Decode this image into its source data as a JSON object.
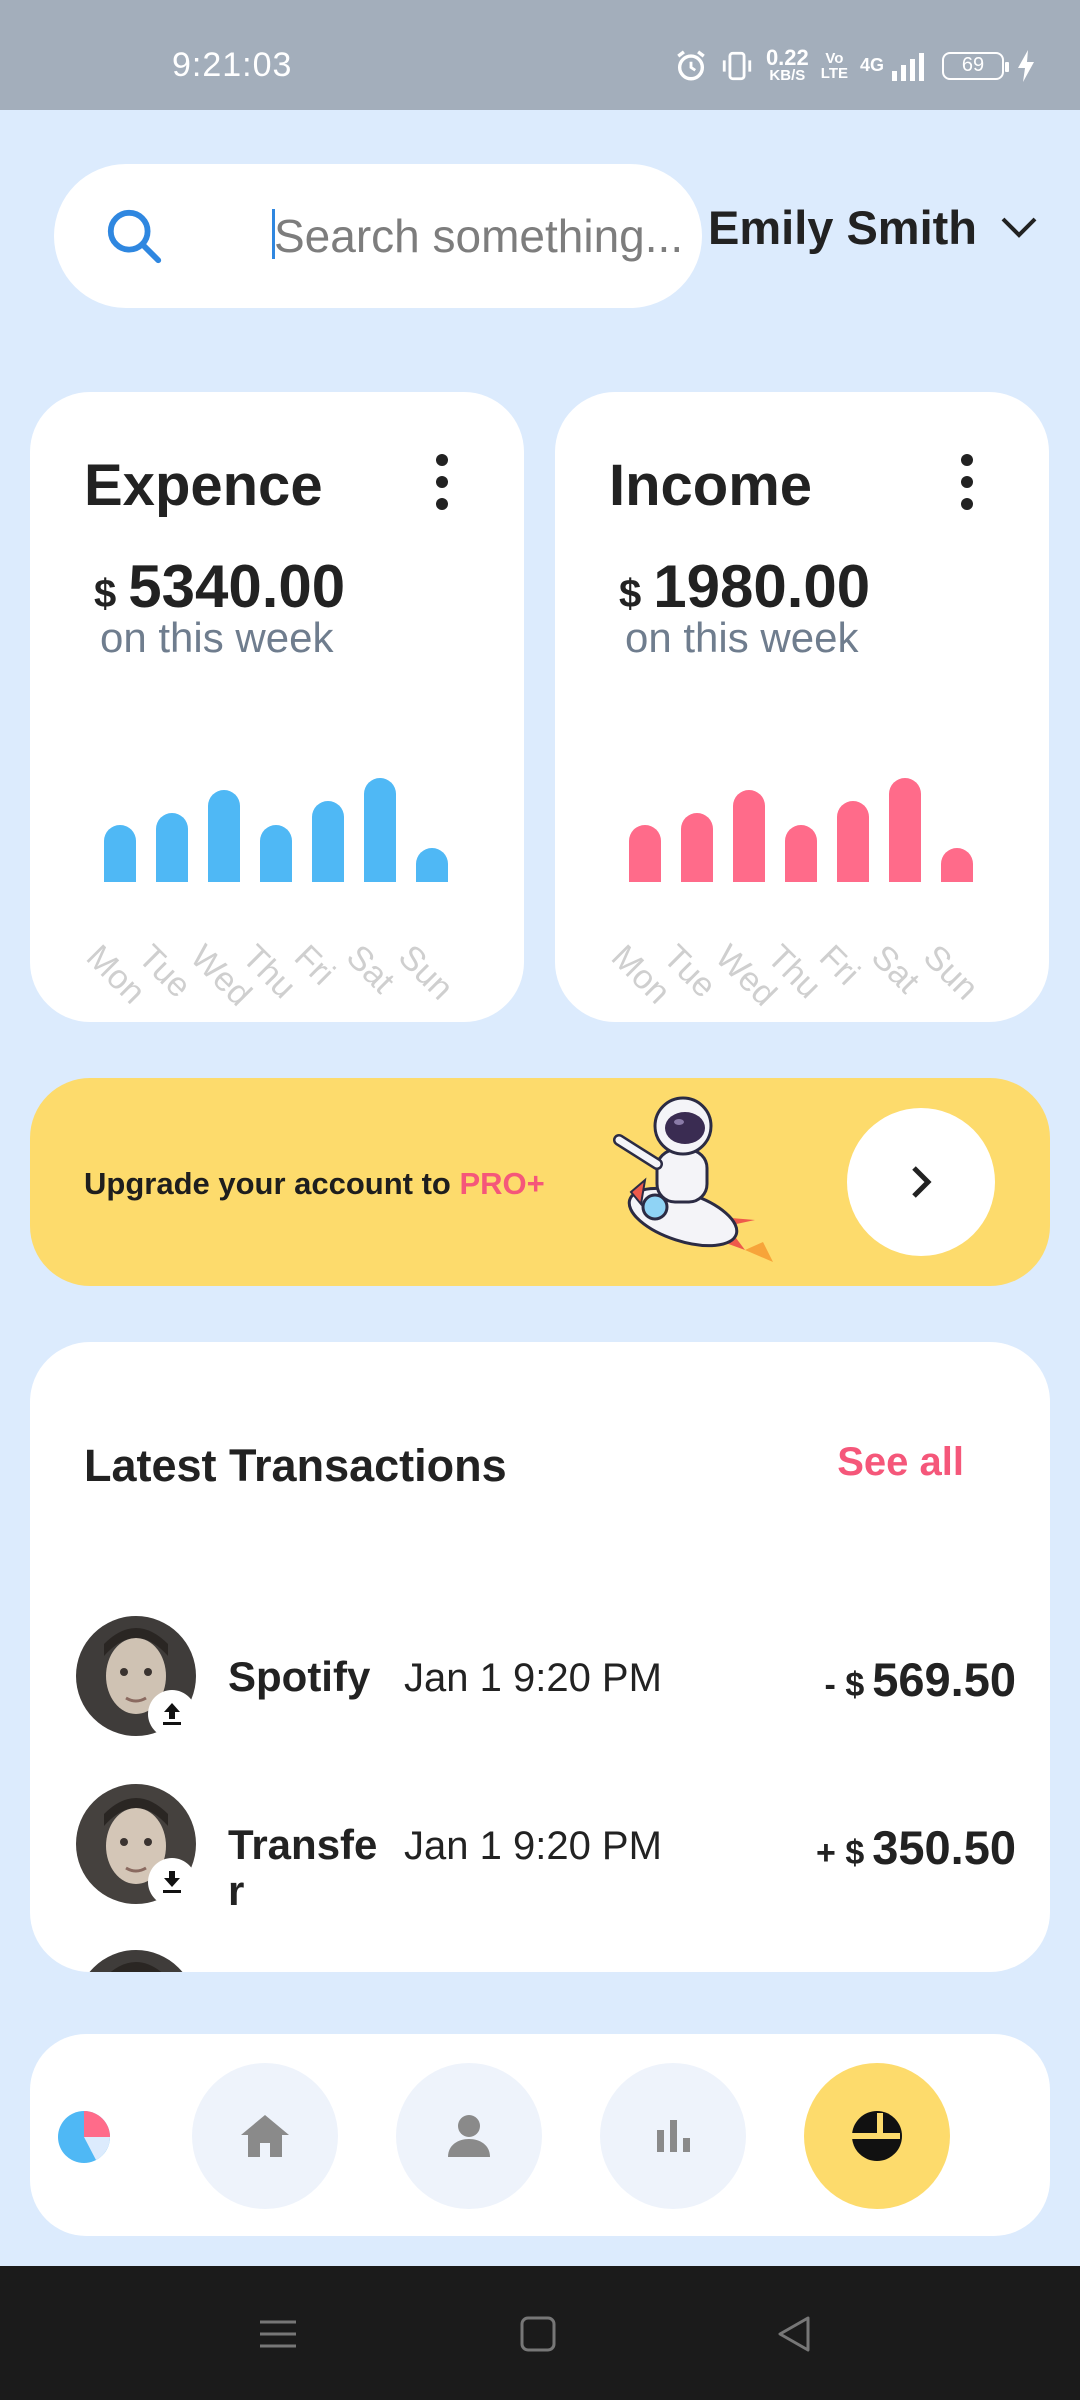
{
  "status_bar": {
    "time": "9:21:03",
    "net_speed_value": "0.22",
    "net_speed_unit": "KB/S",
    "volte_top": "Vo",
    "volte_bottom": "LTE",
    "network": "4G",
    "battery": "69"
  },
  "search": {
    "placeholder": "Search something..."
  },
  "user": {
    "name": "Emily Smith"
  },
  "expense_card": {
    "title": "Expence",
    "currency": "$",
    "amount": "5340.00",
    "period": "on this week",
    "color": "#4FB8F5",
    "days": [
      "Mon",
      "Tue",
      "Wed",
      "Thu",
      "Fri",
      "Sat",
      "Sun"
    ],
    "values": [
      0.55,
      0.66,
      0.88,
      0.55,
      0.78,
      1.0,
      0.33
    ]
  },
  "income_card": {
    "title": "Income",
    "currency": "$",
    "amount": "1980.00",
    "period": "on this week",
    "color": "#FF6B8A",
    "days": [
      "Mon",
      "Tue",
      "Wed",
      "Thu",
      "Fri",
      "Sat",
      "Sun"
    ],
    "values": [
      0.55,
      0.66,
      0.88,
      0.55,
      0.78,
      1.0,
      0.33
    ]
  },
  "promo": {
    "text": "Upgrade your account to ",
    "highlight": "PRO+",
    "image": "astronaut-on-rocket",
    "button_icon": "chevron-right-icon"
  },
  "transactions": {
    "heading": "Latest Transactions",
    "see_all": "See all",
    "items": [
      {
        "label": "Spotify",
        "date": "Jan 1 9:20 PM",
        "sign": "- $",
        "amount": "569.50",
        "direction_icon": "upload-icon"
      },
      {
        "label": "Transfer",
        "date": "Jan 1 9:20 PM",
        "sign": "+ $",
        "amount": "350.50",
        "direction_icon": "download-icon"
      }
    ]
  },
  "bottom_nav": {
    "items": [
      {
        "name": "home",
        "icon": "home-icon"
      },
      {
        "name": "profile",
        "icon": "person-icon"
      },
      {
        "name": "stats",
        "icon": "bar-chart-icon"
      },
      {
        "name": "wallet",
        "icon": "pie-chart-icon",
        "active": true
      }
    ]
  },
  "colors": {
    "accent_yellow": "#FDDB6C",
    "accent_pink": "#F5577A",
    "accent_blue": "#4FB8F5",
    "background": "#DCEBFD"
  }
}
